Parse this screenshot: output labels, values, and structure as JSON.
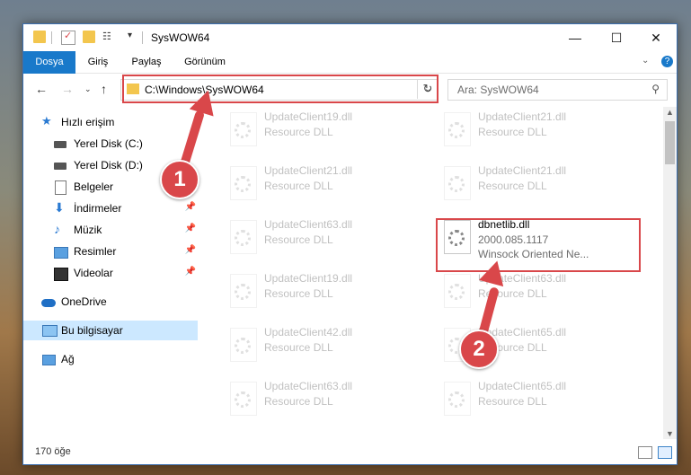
{
  "window": {
    "title": "SysWOW64"
  },
  "ribbon": {
    "tabs": [
      "Dosya",
      "Giriş",
      "Paylaş",
      "Görünüm"
    ]
  },
  "address": {
    "path": "C:\\Windows\\SysWOW64"
  },
  "search": {
    "placeholder": "Ara: SysWOW64"
  },
  "sidebar": {
    "items": [
      {
        "label": "Hızlı erişim"
      },
      {
        "label": "Yerel Disk (C:)"
      },
      {
        "label": "Yerel Disk (D:)"
      },
      {
        "label": "Belgeler"
      },
      {
        "label": "İndirmeler"
      },
      {
        "label": "Müzik"
      },
      {
        "label": "Resimler"
      },
      {
        "label": "Videolar"
      },
      {
        "label": "OneDrive"
      },
      {
        "label": "Bu bilgisayar"
      },
      {
        "label": "Ağ"
      }
    ]
  },
  "files": [
    {
      "name": "UpdateClient19.dll",
      "type": "Resource DLL"
    },
    {
      "name": "UpdateClient21.dll",
      "type": "Resource DLL"
    },
    {
      "name": "UpdateClient21.dll",
      "type": "Resource DLL"
    },
    {
      "name": "UpdateClient21.dll",
      "type": "Resource DLL"
    },
    {
      "name": "UpdateClient63.dll",
      "type": "Resource DLL"
    },
    {
      "name": "dbnetlib.dll",
      "version": "2000.085.1117",
      "description": "Winsock Oriented Ne..."
    },
    {
      "name": "UpdateClient19.dll",
      "type": "Resource DLL"
    },
    {
      "name": "UpdateClient63.dll",
      "type": "Resource DLL"
    },
    {
      "name": "UpdateClient42.dll",
      "type": "Resource DLL"
    },
    {
      "name": "UpdateClient65.dll",
      "type": "Resource DLL"
    },
    {
      "name": "UpdateClient63.dll",
      "type": "Resource DLL"
    },
    {
      "name": "UpdateClient65.dll",
      "type": "Resource DLL"
    }
  ],
  "status": {
    "count": "170 öğe"
  },
  "annotations": {
    "step1": "1",
    "step2": "2"
  },
  "colors": {
    "accent": "#1979ca",
    "highlight": "#d9474a",
    "selected": "#cce8ff"
  }
}
